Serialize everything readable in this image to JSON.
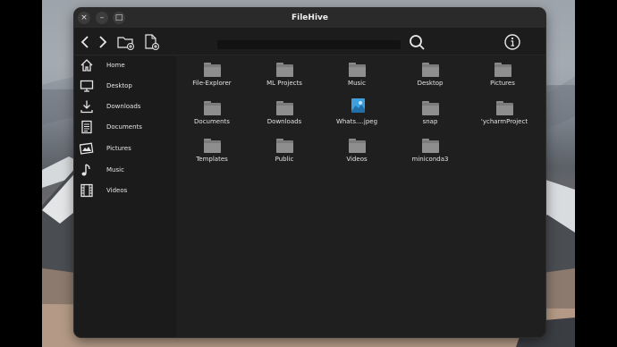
{
  "window": {
    "title": "FileHive",
    "buttons": {
      "close": "×",
      "minimize": "–",
      "maximize": "□"
    }
  },
  "toolbar": {
    "back_icon": "chevron-left-icon",
    "forward_icon": "chevron-right-icon",
    "new_folder_icon": "new-folder-icon",
    "new_file_icon": "new-file-icon",
    "search_icon": "search-icon",
    "info_icon": "info-icon",
    "search_value": "",
    "search_placeholder": ""
  },
  "sidebar": {
    "items": [
      {
        "label": "Home",
        "icon": "home-icon"
      },
      {
        "label": "Desktop",
        "icon": "monitor-icon"
      },
      {
        "label": "Downloads",
        "icon": "download-icon"
      },
      {
        "label": "Documents",
        "icon": "documents-icon"
      },
      {
        "label": "Pictures",
        "icon": "pictures-icon"
      },
      {
        "label": "Music",
        "icon": "music-icon"
      },
      {
        "label": "Videos",
        "icon": "film-icon"
      }
    ]
  },
  "files": [
    {
      "name": "File-Explorer",
      "kind": "folder"
    },
    {
      "name": "ML Projects",
      "kind": "folder"
    },
    {
      "name": "Music",
      "kind": "folder"
    },
    {
      "name": "Desktop",
      "kind": "folder"
    },
    {
      "name": "Pictures",
      "kind": "folder"
    },
    {
      "name": "Documents",
      "kind": "folder"
    },
    {
      "name": "Downloads",
      "kind": "folder"
    },
    {
      "name": "Whats....jpeg",
      "kind": "image"
    },
    {
      "name": "snap",
      "kind": "folder"
    },
    {
      "name": "'ycharmProject",
      "kind": "folder"
    },
    {
      "name": "Templates",
      "kind": "folder"
    },
    {
      "name": "Public",
      "kind": "folder"
    },
    {
      "name": "Videos",
      "kind": "folder"
    },
    {
      "name": "miniconda3",
      "kind": "folder"
    }
  ],
  "colors": {
    "window_bg": "#1f1f1f",
    "titlebar_bg": "#2a2a2a",
    "folder": "#8e8e8e",
    "text": "#e6e6e6"
  }
}
